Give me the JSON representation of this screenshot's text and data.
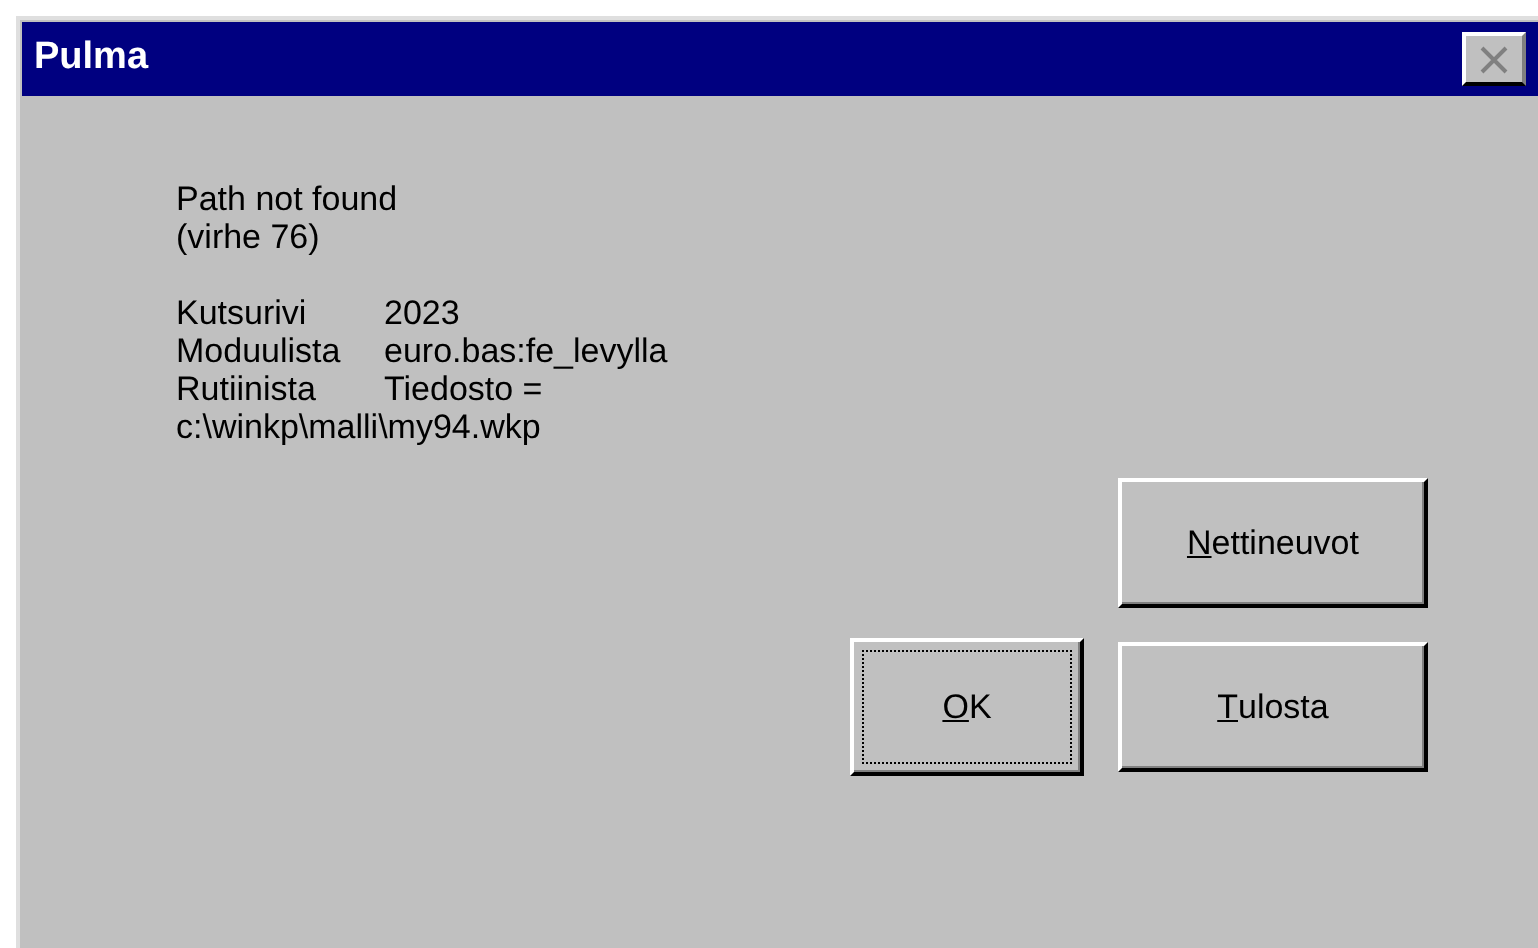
{
  "window": {
    "title": "Pulma",
    "close_disabled": true
  },
  "message": [
    "Path not found",
    "(virhe 76)"
  ],
  "details": [
    {
      "label": "Kutsurivi",
      "value": "2023"
    },
    {
      "label": "Moduulista",
      "value": "euro.bas:fe_levylla"
    },
    {
      "label": "Rutiinista",
      "value": "Tiedosto ="
    }
  ],
  "path": "c:\\winkp\\malli\\my94.wkp",
  "buttons": [
    {
      "label": "Nettineuvot",
      "default": false
    },
    {
      "label": "OK",
      "default": true
    },
    {
      "label": "Tulosta",
      "default": false
    }
  ]
}
